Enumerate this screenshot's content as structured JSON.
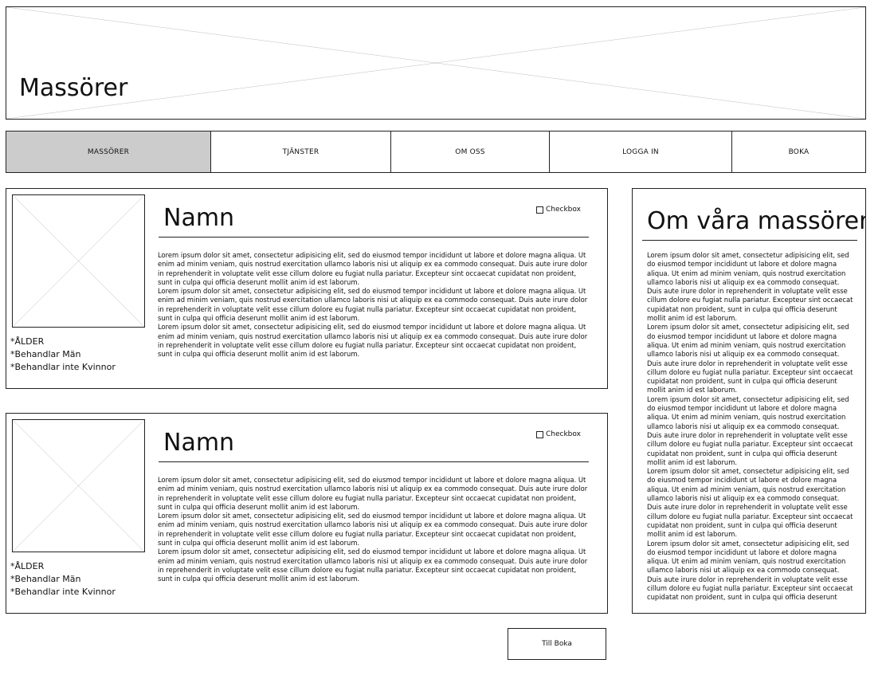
{
  "header": {
    "title": "Massörer"
  },
  "nav": {
    "items": [
      {
        "label": "MASSÖRER",
        "active": true
      },
      {
        "label": "TJÄNSTER",
        "active": false
      },
      {
        "label": "OM OSS",
        "active": false
      },
      {
        "label": "LOGGA IN",
        "active": false
      },
      {
        "label": "BOKA",
        "active": false
      }
    ]
  },
  "cards": [
    {
      "name": "Namn",
      "checkbox_label": "Checkbox",
      "attributes": [
        "*ÅLDER",
        "*Behandlar Män",
        "*Behandlar inte Kvinnor"
      ],
      "paragraphs": [
        "Lorem ipsum dolor sit amet, consectetur adipisicing elit, sed do eiusmod tempor incididunt ut labore et dolore magna aliqua. Ut enim ad minim veniam, quis nostrud exercitation ullamco laboris nisi ut aliquip ex ea commodo consequat. Duis aute irure dolor in reprehenderit in voluptate velit esse cillum dolore eu fugiat nulla pariatur. Excepteur sint occaecat cupidatat non proident, sunt in culpa qui officia deserunt mollit anim id est laborum.",
        "Lorem ipsum dolor sit amet, consectetur adipisicing elit, sed do eiusmod tempor incididunt ut labore et dolore magna aliqua. Ut enim ad minim veniam, quis nostrud exercitation ullamco laboris nisi ut aliquip ex ea commodo consequat. Duis aute irure dolor in reprehenderit in voluptate velit esse cillum dolore eu fugiat nulla pariatur. Excepteur sint occaecat cupidatat non proident, sunt in culpa qui officia deserunt mollit anim id est laborum.",
        "Lorem ipsum dolor sit amet, consectetur adipisicing elit, sed do eiusmod tempor incididunt ut labore et dolore magna aliqua. Ut enim ad minim veniam, quis nostrud exercitation ullamco laboris nisi ut aliquip ex ea commodo consequat. Duis aute irure dolor in reprehenderit in voluptate velit esse cillum dolore eu fugiat nulla pariatur. Excepteur sint occaecat cupidatat non proident, sunt in culpa qui officia deserunt mollit anim id est laborum."
      ]
    },
    {
      "name": "Namn",
      "checkbox_label": "Checkbox",
      "attributes": [
        "*ÅLDER",
        "*Behandlar Män",
        "*Behandlar inte Kvinnor"
      ],
      "paragraphs": [
        "Lorem ipsum dolor sit amet, consectetur adipisicing elit, sed do eiusmod tempor incididunt ut labore et dolore magna aliqua. Ut enim ad minim veniam, quis nostrud exercitation ullamco laboris nisi ut aliquip ex ea commodo consequat. Duis aute irure dolor in reprehenderit in voluptate velit esse cillum dolore eu fugiat nulla pariatur. Excepteur sint occaecat cupidatat non proident, sunt in culpa qui officia deserunt mollit anim id est laborum.",
        "Lorem ipsum dolor sit amet, consectetur adipisicing elit, sed do eiusmod tempor incididunt ut labore et dolore magna aliqua. Ut enim ad minim veniam, quis nostrud exercitation ullamco laboris nisi ut aliquip ex ea commodo consequat. Duis aute irure dolor in reprehenderit in voluptate velit esse cillum dolore eu fugiat nulla pariatur. Excepteur sint occaecat cupidatat non proident, sunt in culpa qui officia deserunt mollit anim id est laborum.",
        "Lorem ipsum dolor sit amet, consectetur adipisicing elit, sed do eiusmod tempor incididunt ut labore et dolore magna aliqua. Ut enim ad minim veniam, quis nostrud exercitation ullamco laboris nisi ut aliquip ex ea commodo consequat. Duis aute irure dolor in reprehenderit in voluptate velit esse cillum dolore eu fugiat nulla pariatur. Excepteur sint occaecat cupidatat non proident, sunt in culpa qui officia deserunt mollit anim id est laborum."
      ]
    }
  ],
  "sidebar": {
    "title": "Om våra massörer",
    "paragraphs": [
      "Lorem ipsum dolor sit amet, consectetur adipisicing elit, sed do eiusmod tempor incididunt ut labore et dolore magna aliqua. Ut enim ad minim veniam, quis nostrud exercitation ullamco laboris nisi ut aliquip ex ea commodo consequat. Duis aute irure dolor in reprehenderit in voluptate velit esse cillum dolore eu fugiat nulla pariatur. Excepteur sint occaecat cupidatat non proident, sunt in culpa qui officia deserunt mollit anim id est laborum.",
      "Lorem ipsum dolor sit amet, consectetur adipisicing elit, sed do eiusmod tempor incididunt ut labore et dolore magna aliqua. Ut enim ad minim veniam, quis nostrud exercitation ullamco laboris nisi ut aliquip ex ea commodo consequat. Duis aute irure dolor in reprehenderit in voluptate velit esse cillum dolore eu fugiat nulla pariatur. Excepteur sint occaecat cupidatat non proident, sunt in culpa qui officia deserunt mollit anim id est laborum.",
      "Lorem ipsum dolor sit amet, consectetur adipisicing elit, sed do eiusmod tempor incididunt ut labore et dolore magna aliqua. Ut enim ad minim veniam, quis nostrud exercitation ullamco laboris nisi ut aliquip ex ea commodo consequat. Duis aute irure dolor in reprehenderit in voluptate velit esse cillum dolore eu fugiat nulla pariatur. Excepteur sint occaecat cupidatat non proident, sunt in culpa qui officia deserunt mollit anim id est laborum.",
      "Lorem ipsum dolor sit amet, consectetur adipisicing elit, sed do eiusmod tempor incididunt ut labore et dolore magna aliqua. Ut enim ad minim veniam, quis nostrud exercitation ullamco laboris nisi ut aliquip ex ea commodo consequat. Duis aute irure dolor in reprehenderit in voluptate velit esse cillum dolore eu fugiat nulla pariatur. Excepteur sint occaecat cupidatat non proident, sunt in culpa qui officia deserunt mollit anim id est laborum.",
      "Lorem ipsum dolor sit amet, consectetur adipisicing elit, sed do eiusmod tempor incididunt ut labore et dolore magna aliqua. Ut enim ad minim veniam, quis nostrud exercitation ullamco laboris nisi ut aliquip ex ea commodo consequat. Duis aute irure dolor in reprehenderit in voluptate velit esse cillum dolore eu fugiat nulla pariatur. Excepteur sint occaecat cupidatat non proident, sunt in culpa qui officia deserunt"
    ]
  },
  "cta": {
    "label": "Till Boka"
  }
}
